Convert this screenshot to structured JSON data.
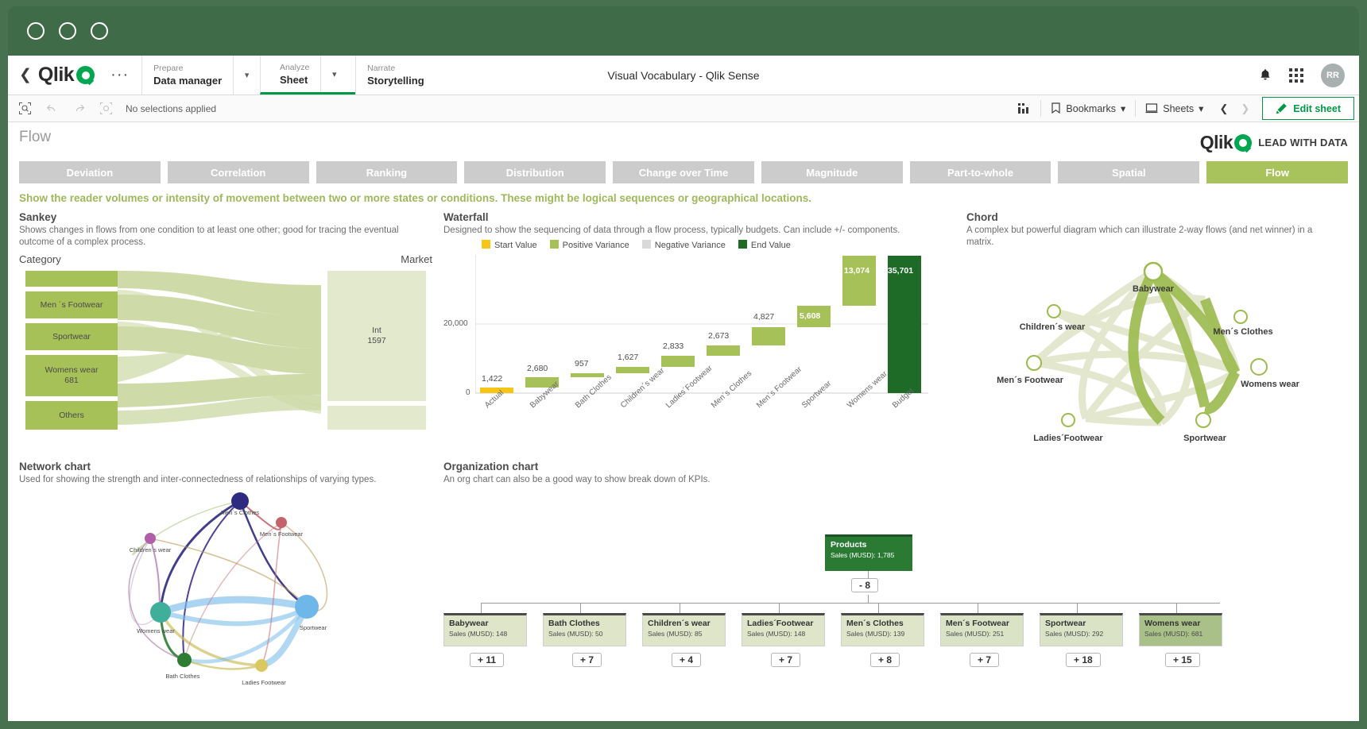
{
  "window": {
    "dots": [
      "minimize",
      "maximize",
      "close"
    ]
  },
  "topnav": {
    "back_icon": "chevron-left-icon",
    "logo_text": "Qlik",
    "overflow": "···",
    "items": [
      {
        "kicker": "Prepare",
        "label": "Data manager",
        "has_caret": true,
        "active": false
      },
      {
        "kicker": "Analyze",
        "label": "Sheet",
        "has_caret": true,
        "active": true
      },
      {
        "kicker": "Narrate",
        "label": "Storytelling",
        "has_caret": false,
        "active": false
      }
    ],
    "app_title": "Visual Vocabulary - Qlik Sense",
    "avatar": "RR"
  },
  "selection_bar": {
    "status": "No selections applied",
    "bookmarks_label": "Bookmarks",
    "sheets_label": "Sheets",
    "edit_sheet_label": "Edit sheet"
  },
  "sheet": {
    "title": "Flow",
    "brand_text": "Qlik",
    "brand_tagline": "LEAD WITH DATA",
    "tabs": [
      {
        "label": "Deviation",
        "active": false
      },
      {
        "label": "Correlation",
        "active": false
      },
      {
        "label": "Ranking",
        "active": false
      },
      {
        "label": "Distribution",
        "active": false
      },
      {
        "label": "Change over Time",
        "active": false
      },
      {
        "label": "Magnitude",
        "active": false
      },
      {
        "label": "Part-to-whole",
        "active": false
      },
      {
        "label": "Spatial",
        "active": false
      },
      {
        "label": "Flow",
        "active": true
      }
    ],
    "subtitle": "Show the reader volumes or intensity of movement between two or more states or conditions. These might be logical sequences or geographical locations."
  },
  "panels": {
    "sankey": {
      "title": "Sankey",
      "desc": "Shows changes in flows from one condition to at least one other; good for tracing the eventual outcome of a complex process.",
      "left_axis": "Category",
      "right_axis": "Market"
    },
    "waterfall": {
      "title": "Waterfall",
      "desc": "Designed to show the sequencing of data through a flow process, typically budgets. Can include +/- components."
    },
    "chord": {
      "title": "Chord",
      "desc": "A complex but powerful diagram which can illustrate 2-way flows (and net winner) in a matrix."
    },
    "network": {
      "title": "Network chart",
      "desc": "Used for showing the strength and inter-connectedness of relationships of varying types."
    },
    "org": {
      "title": "Organization chart",
      "desc": "An org chart can also be a good way to show break down of KPIs."
    }
  },
  "chart_data": [
    {
      "type": "sankey",
      "title": "Sankey",
      "source_axis": "Category",
      "target_axis": "Market",
      "nodes_left": [
        {
          "label": "",
          "value": null
        },
        {
          "label": "Men ´s Footwear",
          "value": null
        },
        {
          "label": "Sportwear",
          "value": null
        },
        {
          "label": "Womens wear",
          "value": 681
        },
        {
          "label": "Others",
          "value": null
        }
      ],
      "nodes_right": [
        {
          "label": "Int",
          "value": 1597
        },
        {
          "label": "",
          "value": null
        }
      ],
      "colors": {
        "left_node": "#a7c159",
        "right_node": "#e3e9cd",
        "link": "#c6d49a"
      }
    },
    {
      "type": "waterfall",
      "title": "Waterfall",
      "categories": [
        "Actual",
        "Babywear",
        "Bath Clothes",
        "Children´s wear",
        "Ladies´Footwear",
        "Men´s Clothes",
        "Men´s Footwear",
        "Sportwear",
        "Womens wear",
        "Budget"
      ],
      "values": [
        1422,
        2680,
        957,
        1627,
        2833,
        2673,
        4827,
        5608,
        13074,
        35701
      ],
      "bar_types": [
        "start",
        "positive",
        "positive",
        "positive",
        "positive",
        "positive",
        "positive",
        "positive",
        "positive",
        "end"
      ],
      "labels": [
        "1,422",
        "2,680",
        "957",
        "1,627",
        "2,833",
        "2,673",
        "4,827",
        "5,608",
        "13,074",
        "35,701"
      ],
      "legend": [
        {
          "label": "Start Value",
          "color": "#f5c518"
        },
        {
          "label": "Positive Variance",
          "color": "#a7c159"
        },
        {
          "label": "Negative Variance",
          "color": "#d9d9d9"
        },
        {
          "label": "End Value",
          "color": "#1e6b28"
        }
      ],
      "ytick_labels": [
        "0",
        "20,000"
      ],
      "ylim": [
        0,
        38000
      ],
      "grid": true
    },
    {
      "type": "chord",
      "title": "Chord",
      "nodes": [
        "Babywear",
        "Men´s Clothes",
        "Womens wear",
        "Sportwear",
        "Ladies´Footwear",
        "Men´s Footwear",
        "Children´s wear"
      ],
      "colors": {
        "strong": "#9cbb4e",
        "weak": "#dde3c6"
      }
    },
    {
      "type": "network",
      "title": "Network chart",
      "nodes": [
        {
          "label": "Men´s Clothes",
          "color": "#3b2f8c"
        },
        {
          "label": "Men´s Footwear",
          "color": "#c4646a"
        },
        {
          "label": "Children´s wear",
          "color": "#b05fa8"
        },
        {
          "label": "Womens wear",
          "color": "#3fae9a"
        },
        {
          "label": "Sportwear",
          "color": "#6fb7e8"
        },
        {
          "label": "Bath Clothes",
          "color": "#2e7d32"
        },
        {
          "label": "Ladies Footwear",
          "color": "#d9c760"
        }
      ]
    },
    {
      "type": "org",
      "title": "Organization chart",
      "root": {
        "label": "Products",
        "metric": "Sales (MUSD): 1,785",
        "badge": "- 8"
      },
      "children": [
        {
          "label": "Babywear",
          "metric": "Sales (MUSD): 148",
          "badge": "+ 11"
        },
        {
          "label": "Bath Clothes",
          "metric": "Sales (MUSD): 50",
          "badge": "+ 7"
        },
        {
          "label": "Children´s wear",
          "metric": "Sales (MUSD): 85",
          "badge": "+ 4"
        },
        {
          "label": "Ladies´Footwear",
          "metric": "Sales (MUSD): 148",
          "badge": "+ 7"
        },
        {
          "label": "Men´s Clothes",
          "metric": "Sales (MUSD): 139",
          "badge": "+ 8"
        },
        {
          "label": "Men´s Footwear",
          "metric": "Sales (MUSD): 251",
          "badge": "+ 7"
        },
        {
          "label": "Sportwear",
          "metric": "Sales (MUSD): 292",
          "badge": "+ 18"
        },
        {
          "label": "Womens wear",
          "metric": "Sales (MUSD): 681",
          "badge": "+ 15"
        }
      ]
    }
  ],
  "colors": {
    "brand_green": "#00a650",
    "accent_green": "#009845",
    "tab_active": "#a9c35c",
    "tab_inactive": "#cccccc",
    "subtitle": "#9eb85a",
    "window_chrome": "#3f6b48"
  }
}
